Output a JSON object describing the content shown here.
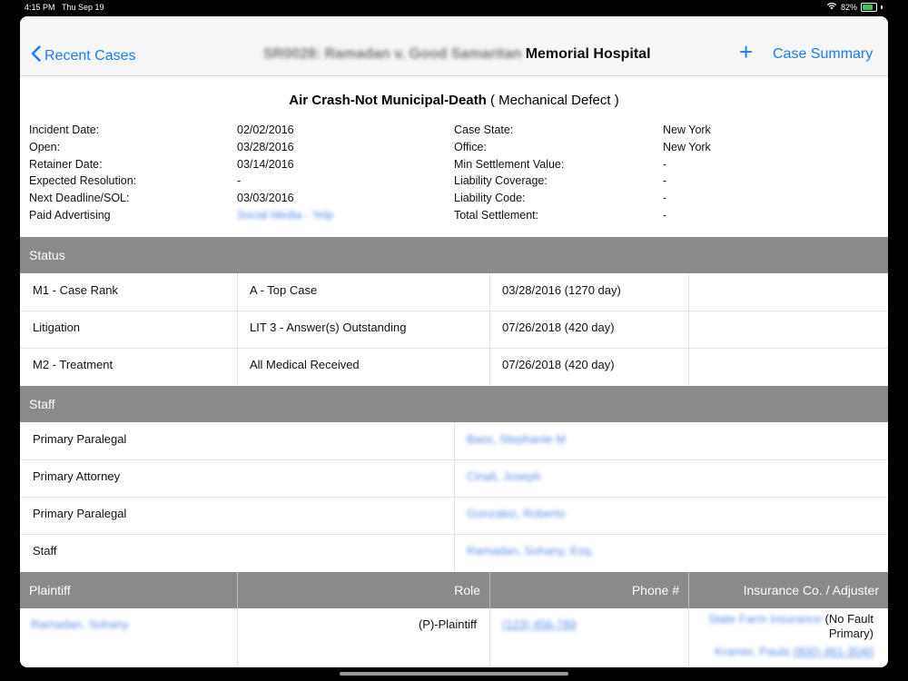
{
  "status_bar": {
    "time": "4:15 PM",
    "date": "Thu Sep 19",
    "battery": "82%",
    "battery_level": 0.82
  },
  "nav": {
    "back_label": "Recent Cases",
    "title_redacted": "SR0028: Ramadan v. Good Samaritan",
    "title_visible": "Memorial Hospital",
    "add_icon": "plus-icon",
    "summary_label": "Case Summary"
  },
  "case": {
    "title_bold": "Air Crash-Not Municipal-Death",
    "title_sub": "( Mechanical Defect )"
  },
  "details_left": [
    {
      "label": "Incident Date:",
      "value": "02/02/2016"
    },
    {
      "label": "Open:",
      "value": "03/28/2016"
    },
    {
      "label": "Retainer Date:",
      "value": "03/14/2016"
    },
    {
      "label": "Expected Resolution:",
      "value": "-"
    },
    {
      "label": "Next Deadline/SOL:",
      "value": "03/03/2016"
    },
    {
      "label": "Paid Advertising",
      "value": "Social Media - Yelp"
    }
  ],
  "details_right": [
    {
      "label": "Case State:",
      "value": "New York"
    },
    {
      "label": "Office:",
      "value": "New York"
    },
    {
      "label": "Min Settlement Value:",
      "value": "-"
    },
    {
      "label": "Liability Coverage:",
      "value": "-"
    },
    {
      "label": "Liability Code:",
      "value": "-"
    },
    {
      "label": "Total Settlement:",
      "value": "-"
    }
  ],
  "status_section": {
    "header": "Status",
    "rows": [
      {
        "name": "M1 - Case Rank",
        "value": "A - Top Case",
        "date": "03/28/2016 (1270 day)"
      },
      {
        "name": "Litigation",
        "value": "LIT 3 - Answer(s) Outstanding",
        "date": "07/26/2018 (420 day)"
      },
      {
        "name": "M2 - Treatment",
        "value": "All Medical Received",
        "date": "07/26/2018 (420 day)"
      }
    ]
  },
  "staff_section": {
    "header": "Staff",
    "rows": [
      {
        "role": "Primary Paralegal",
        "person": "Bass, Stephanie M"
      },
      {
        "role": "Primary Attorney",
        "person": "Cinali, Joseph"
      },
      {
        "role": "Primary Paralegal",
        "person": "Gonzalez, Roberto"
      },
      {
        "role": "Staff",
        "person": "Ramadan, Sohany, Esq."
      }
    ]
  },
  "plaintiff_section": {
    "headers": {
      "plaintiff": "Plaintiff",
      "role": "Role",
      "phone": "Phone #",
      "insurance": "Insurance Co. / Adjuster"
    },
    "row": {
      "name": "Ramadan, Sohany",
      "role": "(P)-Plaintiff",
      "phone": "(123) 456-789",
      "insurance_company": "State Farm Insurance",
      "insurance_type": "(No Fault Primary)",
      "adjuster": "Kramer, Paula",
      "adjuster_phone": "(800) 461-3040"
    }
  }
}
